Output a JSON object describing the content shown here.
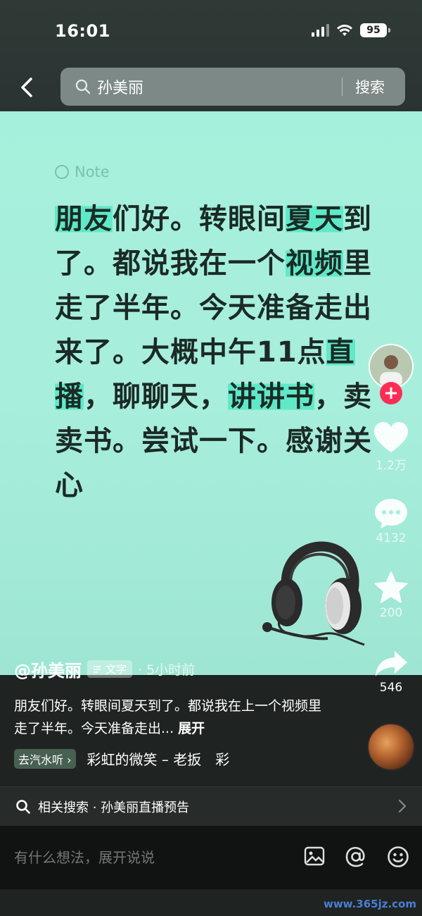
{
  "status_bar": {
    "time": "16:01",
    "battery": "95"
  },
  "search": {
    "query": "孙美丽",
    "button": "搜索"
  },
  "post": {
    "tag": "Note",
    "segments": [
      {
        "text": "朋友",
        "hl": true
      },
      {
        "text": "们好。转眼间",
        "hl": false
      },
      {
        "text": "夏天",
        "hl": true
      },
      {
        "text": "到了。都说我在一个",
        "hl": false
      },
      {
        "text": "视频",
        "hl": true
      },
      {
        "text": "里走了半年。今天准备走出来了。大概中午11点",
        "hl": false
      },
      {
        "text": "直播",
        "hl": true
      },
      {
        "text": "，聊聊天，",
        "hl": false
      },
      {
        "text": "讲讲书",
        "hl": true
      },
      {
        "text": "，卖卖书。尝试一下。感谢关心",
        "hl": false
      }
    ],
    "author": "@孙美丽",
    "type_badge": "文字",
    "time_ago": "· 5小时前"
  },
  "actions": {
    "likes": "1.2万",
    "comments": "4132",
    "favorites": "200",
    "shares": "546"
  },
  "description": {
    "text": "朋友们好。转眼间夏天到了。都说我在上一个视频里走了半年。今天准备走出...",
    "expand": "展开"
  },
  "music": {
    "listen_label": "去汽水听",
    "title": "彩虹的微笑 – 老扳　彩"
  },
  "related": {
    "text": "相关搜索 · 孙美丽直播预告"
  },
  "comment": {
    "placeholder": "有什么想法，展开说说"
  },
  "watermark": "www.365jz.com",
  "colors": {
    "highlight": "#5fe9c8",
    "follow": "#fe2c55",
    "background": "#a5f0dc"
  }
}
